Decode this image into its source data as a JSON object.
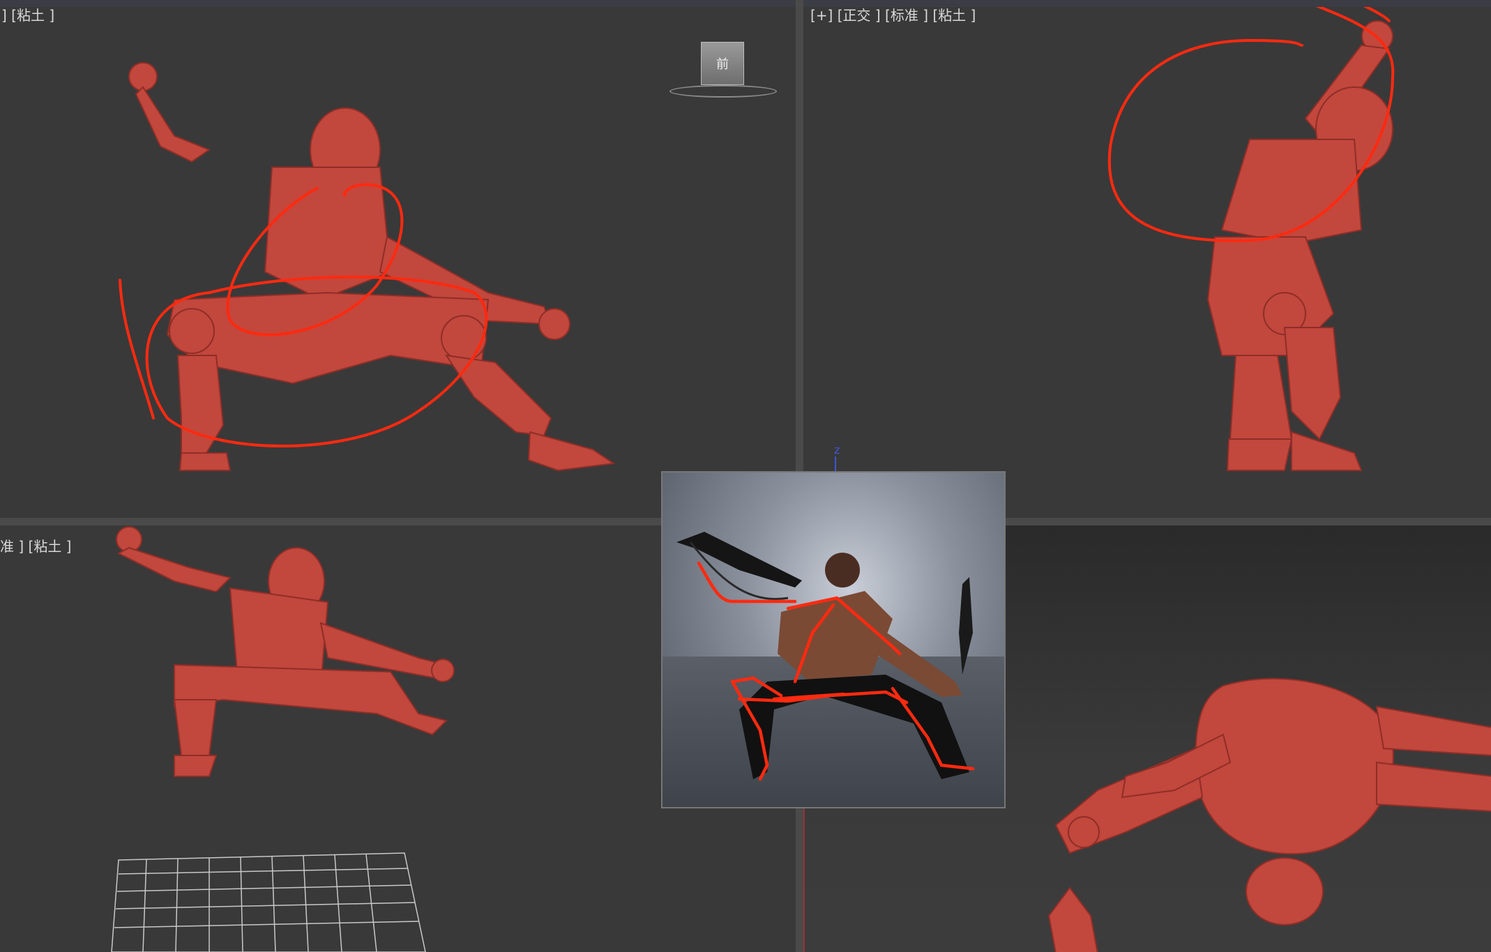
{
  "viewports": {
    "top_left": {
      "label": "] [粘土 ]"
    },
    "top_right": {
      "label": "[+] [正交 ] [标准 ] [粘土 ]"
    },
    "bottom_left": {
      "label": "准 ] [粘土 ]"
    },
    "bottom_right": {
      "label": ""
    }
  },
  "viewcube": {
    "face_label": "前"
  },
  "axis_indicator": {
    "label": "z"
  },
  "colors": {
    "model": "#c2473d",
    "annotation": "#ff2a10",
    "viewport_bg": "#393939",
    "active_border": "#9a3131"
  },
  "icons": [
    "viewcube-icon"
  ]
}
